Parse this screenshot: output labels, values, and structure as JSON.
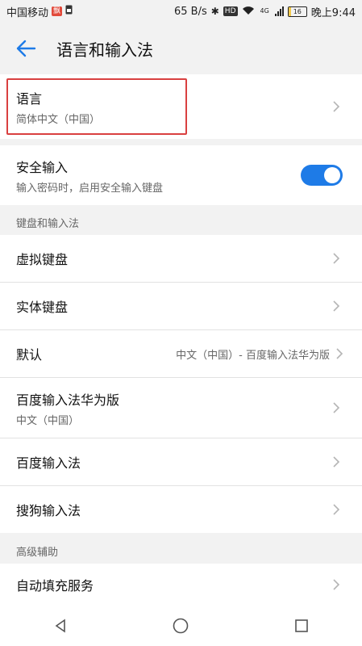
{
  "status": {
    "carrier": "中国移动",
    "badge1": "飘",
    "badge2": "HD",
    "speed": "65 B/s",
    "net": "4G",
    "battery": "16",
    "time": "晚上9:44"
  },
  "header": {
    "title": "语言和输入法"
  },
  "language": {
    "label": "语言",
    "value": "简体中文（中国）"
  },
  "secure_input": {
    "label": "安全输入",
    "desc": "输入密码时，启用安全输入键盘",
    "enabled": true
  },
  "keyboards": {
    "header": "键盘和输入法",
    "virtual_keyboard": "虚拟键盘",
    "physical_keyboard": "实体键盘",
    "default_label": "默认",
    "default_value": "中文（中国）- 百度输入法华为版",
    "baidu_huawei_label": "百度输入法华为版",
    "baidu_huawei_sub": "中文（中国）",
    "baidu": "百度输入法",
    "sogou": "搜狗输入法"
  },
  "advanced": {
    "header": "高级辅助",
    "autofill": "自动填充服务"
  },
  "colors": {
    "accent": "#1e7be7",
    "highlight": "#d94040"
  }
}
